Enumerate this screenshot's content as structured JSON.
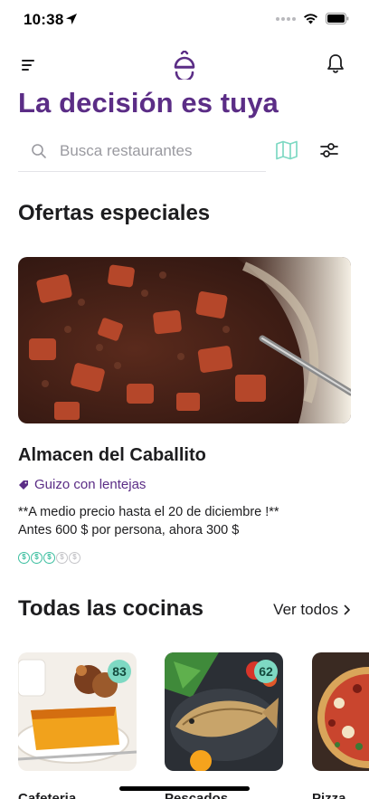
{
  "status_bar": {
    "time": "10:38"
  },
  "nav": {
    "menu_icon": "menu-icon",
    "logo_icon": "bell-cloche-logo",
    "notifications_icon": "bell-icon"
  },
  "header": {
    "title": "La decisión es tuya"
  },
  "search": {
    "placeholder": "Busca restaurantes",
    "value": "",
    "map_icon": "map-icon",
    "filter_icon": "sliders-icon"
  },
  "offers": {
    "section_title": "Ofertas especiales",
    "items": [
      {
        "restaurant": "Almacen del Caballito",
        "dish": "Guizo con lentejas",
        "description_line1": "**A medio precio hasta el 20 de diciembre !**",
        "description_line2": "Antes 600 $ por persona, ahora 300 $",
        "price_level": 3,
        "price_level_max": 5
      }
    ]
  },
  "cuisines": {
    "section_title": "Todas las cocinas",
    "see_all_label": "Ver todos",
    "items": [
      {
        "label": "Cafeteria",
        "count": "83"
      },
      {
        "label": "Pescados",
        "count": "62"
      },
      {
        "label": "Pizza",
        "count": ""
      }
    ]
  },
  "colors": {
    "brand_purple": "#5b2d86",
    "accent_teal": "#3dbfa0",
    "badge_teal": "#7ed9c3"
  }
}
